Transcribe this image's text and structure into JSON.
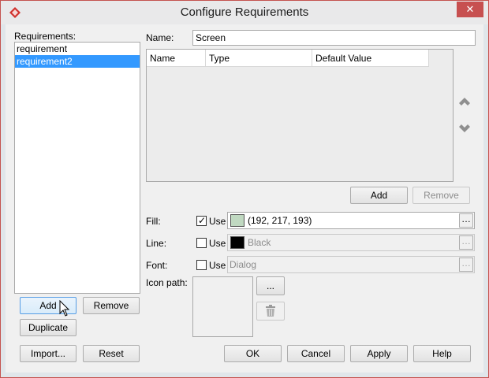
{
  "window": {
    "title": "Configure Requirements",
    "close_glyph": "✕"
  },
  "requirements": {
    "label": "Requirements:",
    "items": [
      {
        "label": "requirement",
        "selected": false
      },
      {
        "label": "requirement2",
        "selected": true
      }
    ],
    "add_label": "Add",
    "remove_label": "Remove",
    "duplicate_label": "Duplicate"
  },
  "name": {
    "label": "Name:",
    "value": "Screen"
  },
  "properties_table": {
    "columns": [
      "Name",
      "Type",
      "Default Value"
    ],
    "rows": [],
    "add_label": "Add",
    "remove_label": "Remove",
    "move_up_icon": "chevron-up-icon",
    "move_down_icon": "chevron-down-icon"
  },
  "fill": {
    "label": "Fill:",
    "use_label": "Use",
    "use_checked": true,
    "value": "(192, 217, 193)",
    "color": "#c0d9c1"
  },
  "line": {
    "label": "Line:",
    "use_label": "Use",
    "use_checked": false,
    "value": "Black",
    "color": "#000000"
  },
  "font": {
    "label": "Font:",
    "use_label": "Use",
    "use_checked": false,
    "value": "Dialog"
  },
  "icon_path": {
    "label": "Icon path:",
    "browse_label": "...",
    "delete_icon": "trash-icon"
  },
  "footer": {
    "import_label": "Import...",
    "reset_label": "Reset",
    "ok_label": "OK",
    "cancel_label": "Cancel",
    "apply_label": "Apply",
    "help_label": "Help"
  },
  "colors": {
    "selection": "#3399ff",
    "title_border": "#c4534f",
    "close_button": "#c75050"
  }
}
